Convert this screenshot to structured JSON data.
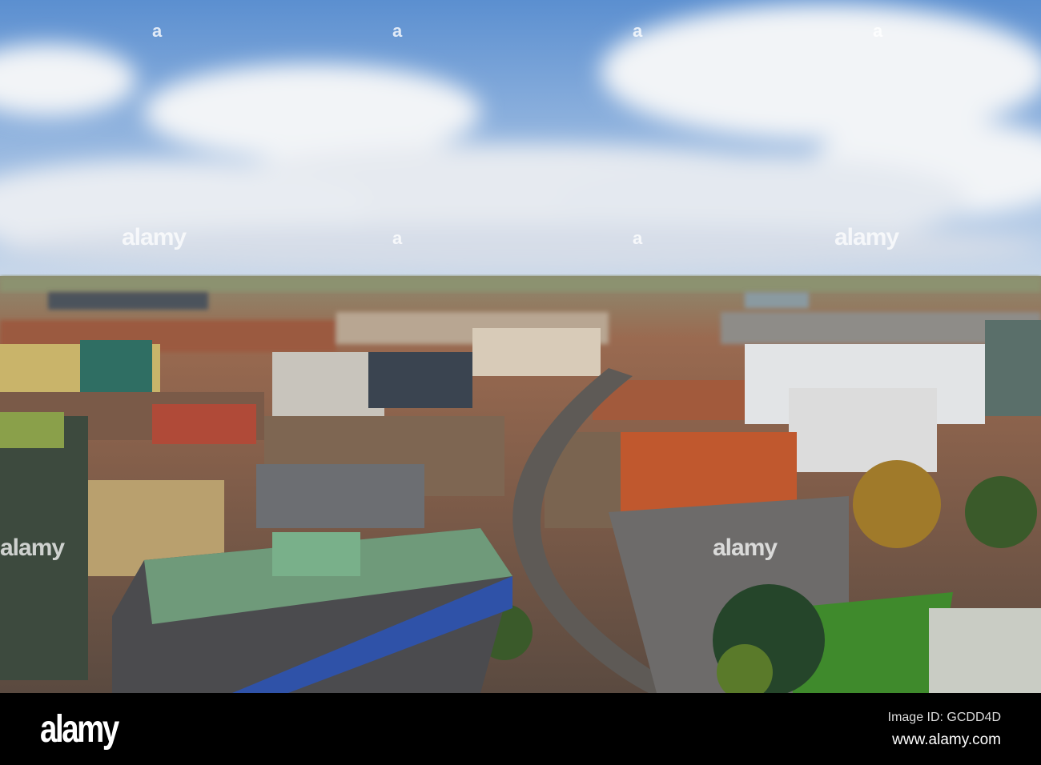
{
  "photo": {
    "colors": {
      "sky_top": "#5b8fd0",
      "sky_bottom": "#c9d8ea",
      "cloud": "#f2f4f7",
      "brick": "#a0573a",
      "lawn": "#3f8a2c",
      "slate": "#4a4b50"
    }
  },
  "watermark": {
    "text": "alamy",
    "dots": "a"
  },
  "footer": {
    "logo": "alamy",
    "image_id": "Image ID: GCDD4D",
    "website": "www.alamy.com"
  }
}
